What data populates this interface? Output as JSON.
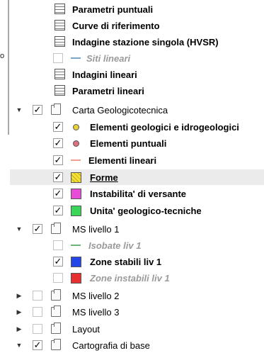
{
  "left_panel": {
    "text": "o"
  },
  "tree": {
    "rows": [
      {
        "label": "Parametri puntuali",
        "kind": "table",
        "bold": true
      },
      {
        "label": "Curve di riferimento",
        "kind": "table",
        "bold": true
      },
      {
        "label": "Indagine stazione singola (HVSR)",
        "kind": "table",
        "bold": true
      },
      {
        "label": "Siti lineari",
        "kind": "line-layer",
        "checked": false,
        "dim": true,
        "color": "#7aa6c8"
      },
      {
        "label": "Indagini lineari",
        "kind": "table",
        "bold": true
      },
      {
        "label": "Parametri lineari",
        "kind": "table",
        "bold": true
      },
      {
        "label": "Carta Geologicotecnica",
        "kind": "group",
        "expanded": true,
        "checked": true
      },
      {
        "label": "Elementi geologici e idrogeologici",
        "kind": "point-layer",
        "checked": true,
        "color": "#e8d23a"
      },
      {
        "label": "Elementi puntuali",
        "kind": "point-layer",
        "checked": true,
        "color": "#e07080"
      },
      {
        "label": "Elementi lineari",
        "kind": "line-layer",
        "checked": true,
        "color": "#f0a090"
      },
      {
        "label": "Forme",
        "kind": "fill-layer",
        "checked": true,
        "color": "#f2e234",
        "selected": true
      },
      {
        "label": "Instabilita' di versante",
        "kind": "fill-layer",
        "checked": true,
        "color": "#e84bd8"
      },
      {
        "label": "Unita' geologico-tecniche",
        "kind": "fill-layer",
        "checked": true,
        "color": "#3ad65a"
      },
      {
        "label": "MS livello 1",
        "kind": "group",
        "expanded": true,
        "checked": true
      },
      {
        "label": "Isobate liv 1",
        "kind": "line-layer",
        "checked": false,
        "dim": true,
        "color": "#6ab67a"
      },
      {
        "label": "Zone stabili liv 1",
        "kind": "fill-layer",
        "checked": true,
        "color": "#2346e8"
      },
      {
        "label": "Zone instabili liv 1",
        "kind": "fill-layer",
        "checked": false,
        "dim": true,
        "color": "#e82f2f"
      },
      {
        "label": "MS livello 2",
        "kind": "group",
        "expanded": false,
        "checked": false
      },
      {
        "label": "MS livello 3",
        "kind": "group",
        "expanded": false,
        "checked": false
      },
      {
        "label": "Layout",
        "kind": "group",
        "expanded": false,
        "checked": false
      },
      {
        "label": "Cartografia di base",
        "kind": "group",
        "expanded": true,
        "checked": true
      }
    ]
  }
}
